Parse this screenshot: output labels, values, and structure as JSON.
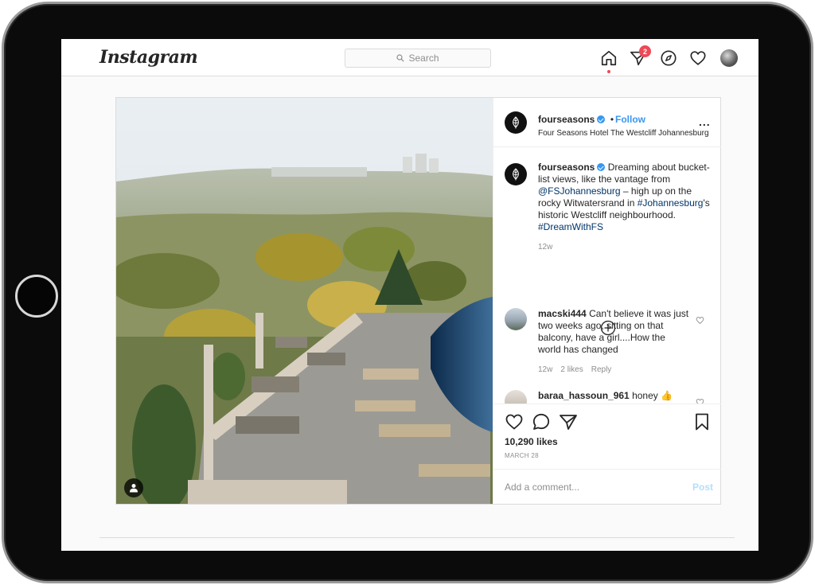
{
  "header": {
    "logo": "Instagram",
    "search_placeholder": "Search",
    "activity_badge": "2"
  },
  "post": {
    "author": "fourseasons",
    "follow_label": "Follow",
    "separator": "•",
    "location": "Four Seasons Hotel The Westcliff Johannesburg",
    "more_label": "...",
    "caption": {
      "author": "fourseasons",
      "text_1": " Dreaming about bucket-list views, like the vantage from ",
      "mention": "@FSJohannesburg",
      "text_2": " – high up on the rocky Witwatersrand in ",
      "hashtag_1": "#Johannesburg",
      "text_3": "'s historic Westcliff neighbourhood. ",
      "hashtag_2": "#DreamWithFS",
      "age": "12w"
    },
    "comments": [
      {
        "author": "macski444",
        "text": " Can't believe it was just two weeks ago, sitting on that balcony, have a girl....How the world has changed",
        "age": "12w",
        "likes": "2 likes",
        "reply": "Reply"
      },
      {
        "author": "baraa_hassoun_961",
        "text": " honey 👍",
        "age": "",
        "likes": "",
        "reply": ""
      }
    ],
    "likes": "10,290 likes",
    "date": "MARCH 28",
    "comment_placeholder": "Add a comment...",
    "post_label": "Post"
  },
  "colors": {
    "accent_blue": "#3897f0",
    "badge_red": "#ed4956",
    "post_button_disabled": "#b2dffc"
  }
}
